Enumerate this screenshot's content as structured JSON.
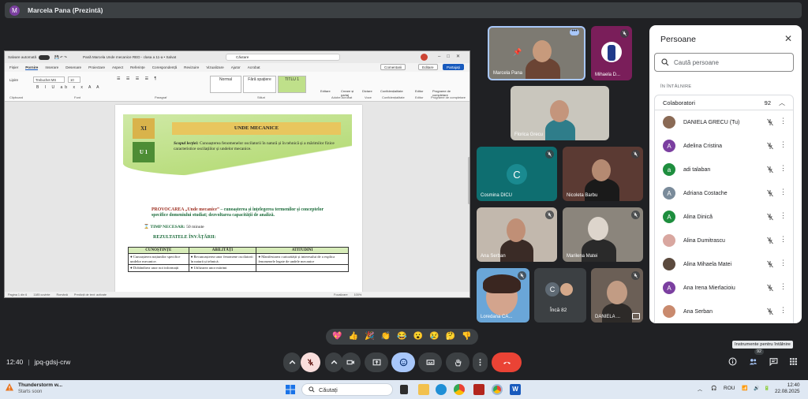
{
  "presenter_bar": {
    "avatar_letter": "M",
    "label": "Marcela Pana (Prezintă)"
  },
  "word": {
    "autosave": "Salvare automată",
    "doc_title": "Pană Marcela Unde mecanice RED - clasa a 11-a • Salvat",
    "search_placeholder": "Căutare",
    "menu": [
      "Fișier",
      "Pornire",
      "Inserare",
      "Desenare",
      "Proiectare",
      "Aspect",
      "Referințe",
      "Corespondență",
      "Revizuire",
      "Vizualizare",
      "Ajutor",
      "Acrobat"
    ],
    "menu_active": "Pornire",
    "comments_btn": "Comentarii",
    "editing_btn": "Editare",
    "share_btn": "Partajați",
    "font_name": "Trebuchet MS",
    "font_size": "10",
    "styles": [
      "Normal",
      "Fără spațiere",
      "TITLU 1"
    ],
    "ribbon_groups": [
      "Clipboard",
      "Font",
      "Paragraf",
      "Stiluri",
      "Adobe Acrobat",
      "Voce",
      "Confidențialitate",
      "Editor",
      "Programe de completare"
    ],
    "ribbon_tools": [
      "Lipire",
      "Editare",
      "Creare și partaj",
      "Dictare",
      "Confidențialitate",
      "Editor",
      "Programe de completare"
    ],
    "page": {
      "grade": "XI",
      "unit": "U 1",
      "title": "UNDE MECANICE",
      "scope_label": "Scopul lecției:",
      "scope_text": "Cunoașterea fenomenelor oscilatorii în natură și în tehnică și a mărimilor fizice caracteristice oscilațiilor și undelor mecanice.",
      "prov_label": "PROVOCAREA „Unde mecanice”",
      "prov_text": "– cunoașterea și înțelegerea termenilor și conceptelor specifice domeniului studiat; dezvoltarea capacității de analiză.",
      "time_label": "TIMP NECESAR:",
      "time_value": "50 minute",
      "results_label": "REZULTATELE ÎNVĂȚĂRII:",
      "table_headers": [
        "CUNOȘTINȚE",
        "ABILITĂȚI",
        "ATITUDINI"
      ],
      "table_rows": [
        [
          "● Cunoașterea noțiunilor specifice undelor mecanice.",
          "● Recunoașterea unor fenomene oscilatorii în natură și tehnică;",
          "● Manifestarea curiozității și interesului de a explica fenomenele legate de undele mecanice"
        ],
        [
          "● Dobândirea unor noi informații",
          "● Utilizarea unor mărimi",
          ""
        ]
      ]
    },
    "status": [
      "Pagina 1 din 6",
      "1185 cuvinte",
      "Română",
      "Predicții de text: activate",
      "Focalizare",
      "100%"
    ]
  },
  "tiles": [
    {
      "name": "Marcela Pana",
      "muted": false
    },
    {
      "name": "Mihaela D...",
      "muted": true
    },
    {
      "name": "Florica Grecu",
      "muted": false
    },
    {
      "name": "Cosmina DICU",
      "muted": true,
      "letter": "C"
    },
    {
      "name": "Nicoleta Barbu",
      "muted": true
    },
    {
      "name": "Ana Serban",
      "muted": true
    },
    {
      "name": "Marilena Matei",
      "muted": true
    },
    {
      "name": "Loredana CA...",
      "muted": true
    },
    {
      "name": "Încă 82",
      "muted": false,
      "letter": "C"
    },
    {
      "name": "DANIELA ...",
      "muted": true
    }
  ],
  "people": {
    "title": "Persoane",
    "search_placeholder": "Caută persoane",
    "section": "ÎN ÎNTÂLNIRE",
    "group_label": "Colaboratori",
    "group_count": "92",
    "list": [
      {
        "name": "DANIELA GRECU (Tu)",
        "letter": "",
        "color": "#8a6a55"
      },
      {
        "name": "Adelina Cristina",
        "letter": "A",
        "color": "#7b3fa0"
      },
      {
        "name": "adi talaban",
        "letter": "a",
        "color": "#1e8e3e"
      },
      {
        "name": "Adriana Costache",
        "letter": "A",
        "color": "#7a8b9a"
      },
      {
        "name": "Alina Dinică",
        "letter": "A",
        "color": "#1e8e3e"
      },
      {
        "name": "Alina Dumitrascu",
        "letter": "",
        "color": "#d9a7a0"
      },
      {
        "name": "Alina Mihaela Matei",
        "letter": "",
        "color": "#5b4a3e"
      },
      {
        "name": "Ana Irena Mierlacioiu",
        "letter": "A",
        "color": "#7b3fa0"
      },
      {
        "name": "Ana Serban",
        "letter": "",
        "color": "#c98a6e"
      }
    ]
  },
  "reactions": [
    "💖",
    "👍",
    "🎉",
    "👏",
    "😂",
    "😮",
    "😢",
    "🤔",
    "👎"
  ],
  "meeting": {
    "time": "12:40",
    "code": "jpq-gdsj-crw"
  },
  "tooltip": "Instrumente pentru întâlnire",
  "people_badge": "92",
  "taskbar": {
    "weather_title": "Thunderstorm w...",
    "weather_sub": "Starts soon",
    "search_placeholder": "Căutați",
    "lang": "ROU",
    "time": "12:40",
    "date": "22.08.2025"
  },
  "colors": {
    "meet_bg": "#202124",
    "end_call": "#ea4335",
    "word_blue": "#185abd",
    "green_band": "#b9dd7d"
  }
}
